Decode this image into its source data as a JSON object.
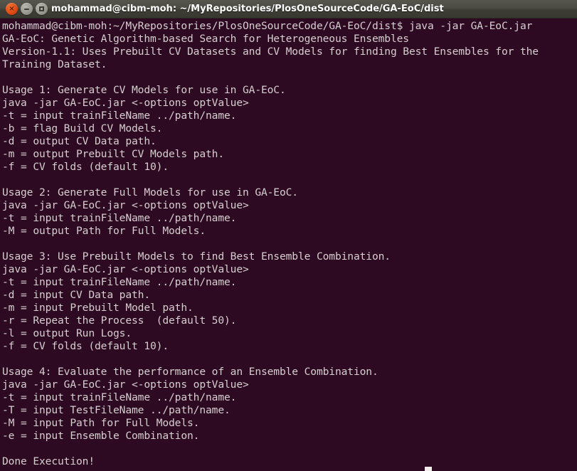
{
  "window": {
    "title": "mohammad@cibm-moh: ~/MyRepositories/PlosOneSourceCode/GA-EoC/dist",
    "buttons": {
      "close_label": "×",
      "close_name": "close-window-button",
      "minimize_name": "minimize-window-button",
      "maximize_name": "maximize-window-button"
    },
    "colors": {
      "titlebar_bg": "#4b4b44",
      "close_button": "#dd4814",
      "terminal_bg": "#2d0922",
      "terminal_fg": "#d6cfd0",
      "cursor": "#f2ecec"
    }
  },
  "terminal": {
    "prompt": "mohammad@cibm-moh:~/MyRepositories/PlosOneSourceCode/GA-EoC/dist$",
    "command": "java -jar GA-EoC.jar",
    "lines": [
      "mohammad@cibm-moh:~/MyRepositories/PlosOneSourceCode/GA-EoC/dist$ java -jar GA-EoC.jar",
      "GA-EoC: Genetic Algorithm-based Search for Heterogeneous Ensembles",
      "Version-1.1: Uses Prebuilt CV Datasets and CV Models for finding Best Ensembles for the",
      "Training Dataset.",
      "",
      "Usage 1: Generate CV Models for use in GA-EoC.",
      "java -jar GA-EoC.jar <-options optValue>",
      "-t = input trainFileName ../path/name.",
      "-b = flag Build CV Models.",
      "-d = output CV Data path.",
      "-m = output Prebuilt CV Models path.",
      "-f = CV folds (default 10).",
      "",
      "Usage 2: Generate Full Models for use in GA-EoC.",
      "java -jar GA-EoC.jar <-options optValue>",
      "-t = input trainFileName ../path/name.",
      "-M = output Path for Full Models.",
      "",
      "Usage 3: Use Prebuilt Models to find Best Ensemble Combination.",
      "java -jar GA-EoC.jar <-options optValue>",
      "-t = input trainFileName ../path/name.",
      "-d = input CV Data path.",
      "-m = input Prebuilt Model path.",
      "-r = Repeat the Process  (default 50).",
      "-l = output Run Logs.",
      "-f = CV folds (default 10).",
      "",
      "Usage 4: Evaluate the performance of an Ensemble Combination.",
      "java -jar GA-EoC.jar <-options optValue>",
      "-t = input trainFileName ../path/name.",
      "-T = input TestFileName ../path/name.",
      "-M = input Path for Full Models.",
      "-e = input Ensemble Combination.",
      "",
      "Done Execution!"
    ]
  }
}
